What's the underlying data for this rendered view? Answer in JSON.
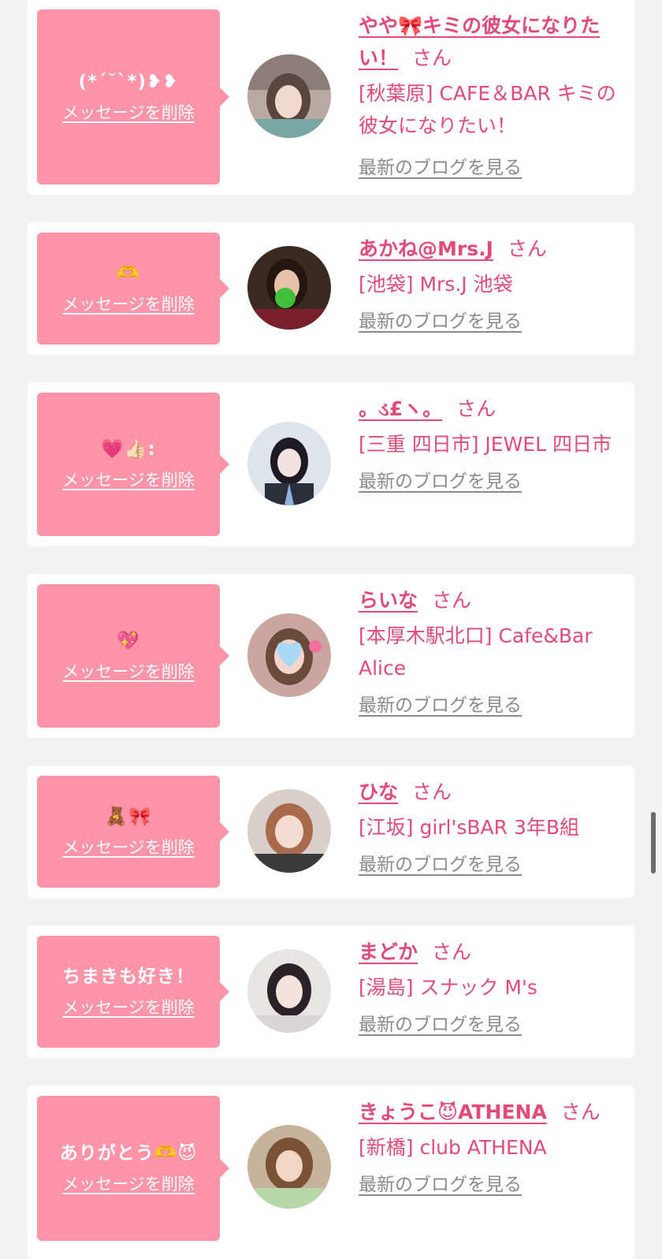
{
  "delete_label": "メッセージを削除",
  "blog_label": "最新のブログを見る",
  "colors": {
    "background": "#f2f2f2",
    "card": "#ffffff",
    "bubble": "#ff93a7",
    "accent": "#e44a78",
    "link_gray": "#8a8a8a"
  },
  "entries": [
    {
      "message": "(*´˘`*)❥❥",
      "name": "やや🎀キミの彼女になりたい！",
      "honorific": "さん",
      "shop": "[秋葉原] CAFE＆BAR キミの彼女になりたい！"
    },
    {
      "message": "🫶",
      "name": "あかね@Mrs.J",
      "honorific": "さん",
      "shop": "[池袋] Mrs.J 池袋"
    },
    {
      "message": "💗👍🏻:",
      "name": "。ડ£ヽ。",
      "honorific": "さん",
      "shop": "[三重 四日市] JEWEL 四日市"
    },
    {
      "message": "💖",
      "name": "らいな",
      "honorific": "さん",
      "shop": "[本厚木駅北口] Cafe&Bar Alice"
    },
    {
      "message": "🧸🎀",
      "name": "ひな",
      "honorific": "さん",
      "shop": "[江坂] girl'sBAR 3年B組"
    },
    {
      "message": "ちまきも好き！",
      "name": "まどか",
      "honorific": "さん",
      "shop": "[湯島] スナック M's"
    },
    {
      "message": "ありがとう🫶😈",
      "name": "きょうこ😈ATHENA",
      "honorific": "さん",
      "shop": "[新橋] club ATHENA"
    }
  ]
}
